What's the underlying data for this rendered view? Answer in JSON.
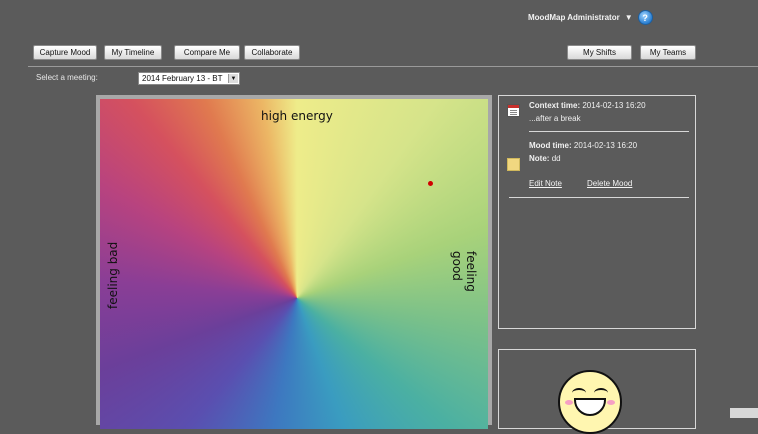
{
  "header": {
    "user_menu": "MoodMap Administrator",
    "help_icon_glyph": "?"
  },
  "toolbar": {
    "capture_mood": "Capture Mood",
    "my_timeline": "My Timeline",
    "compare_me": "Compare Me",
    "collaborate": "Collaborate",
    "my_shifts": "My Shifts",
    "my_teams": "My Teams"
  },
  "meeting": {
    "label": "Select a meeting:",
    "selected": "2014 February 13 - BT"
  },
  "moodmap": {
    "top_label": "high energy",
    "left_label": "feeling bad",
    "right_label": "feeling good"
  },
  "details": {
    "context_label": "Context time:",
    "context_time": "2014-02-13 16:20",
    "context_note": "...after a break",
    "mood_label": "Mood time:",
    "mood_time": "2014-02-13 16:20",
    "note_label": "Note:",
    "note_value": "dd",
    "edit_note": "Edit Note",
    "delete_mood": "Delete Mood"
  },
  "colors": {
    "background": "#5b5b5b",
    "mood_dot": "#d00000",
    "mood_swatch": "#f1d780"
  }
}
